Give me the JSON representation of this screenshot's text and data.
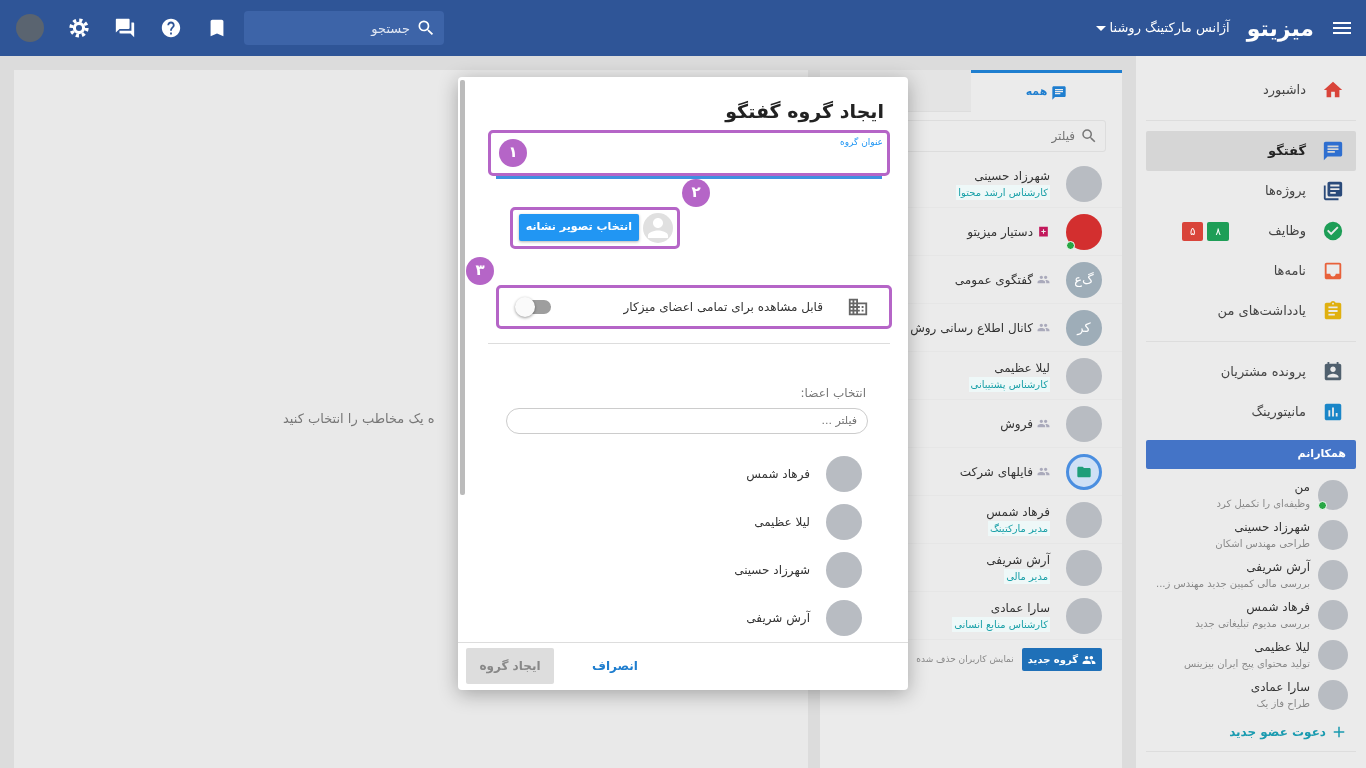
{
  "topbar": {
    "logo": "میزیتو",
    "workspace": "آژانس مارکتینگ روشنا",
    "search": {
      "placeholder": "جستجو"
    }
  },
  "sidebar": {
    "sections": [
      [
        {
          "label": "داشبورد",
          "selected": false
        }
      ],
      [
        {
          "label": "گفتگو",
          "selected": true
        },
        {
          "label": "پروژه‌ها",
          "selected": false
        },
        {
          "label": "وظایف",
          "selected": false,
          "badges": [
            {
              "text": "۸",
              "color": "#1e9e57"
            },
            {
              "text": "۵",
              "color": "#d9443a"
            }
          ]
        },
        {
          "label": "نامه‌ها",
          "selected": false
        },
        {
          "label": "یادداشت‌های من",
          "selected": false
        }
      ],
      [
        {
          "label": "پرونده مشتریان",
          "selected": false
        },
        {
          "label": "مانیتورینگ",
          "selected": false
        }
      ]
    ],
    "colleagues": {
      "title": "همکارانم",
      "items": [
        {
          "name": "من",
          "status": "وظیفه‌ای را تکمیل کرد",
          "online": true
        },
        {
          "name": "شهرزاد حسینی",
          "status": "طراحی مهندس اشکان",
          "online": false
        },
        {
          "name": "آرش شریفی",
          "status": "بررسی مالی کمپین جدید مهندس ز...",
          "online": false
        },
        {
          "name": "فرهاد شمس",
          "status": "بررسی مدیوم تبلیغاتی جدید",
          "online": false
        },
        {
          "name": "لیلا عظیمی",
          "status": "تولید محتوای پیج ایران بیزینس",
          "online": false
        },
        {
          "name": "سارا عمادی",
          "status": "طراح فاز یک",
          "online": false
        }
      ],
      "invite": "دعوت عضو جدید"
    }
  },
  "chat_list": {
    "tabs": [
      {
        "label": "همه",
        "selected": true
      },
      {
        "selected": false
      }
    ],
    "filter": {
      "placeholder": "فیلتر"
    },
    "items": [
      {
        "kind": "person",
        "avatar": {
          "kind": "photo"
        },
        "name": "شهرزاد حسینی",
        "role": "کارشناس ارشد محتوا"
      },
      {
        "kind": "bot",
        "avatar": {
          "kind": "logo"
        },
        "name": "دستیار میزیتو",
        "online": true
      },
      {
        "kind": "group",
        "avatar": {
          "kind": "initials",
          "initials": "گ‌ع"
        },
        "name": "گفتگوی عمومی"
      },
      {
        "kind": "channel",
        "avatar": {
          "kind": "initials",
          "initials": "کر"
        },
        "name": "کانال اطلاع رسانی روش"
      },
      {
        "kind": "person",
        "avatar": {
          "kind": "photo"
        },
        "name": "لیلا عظیمی",
        "role": "کارشناس پشتیبانی"
      },
      {
        "kind": "group",
        "avatar": {
          "kind": "photo"
        },
        "name": "فروش"
      },
      {
        "kind": "channel",
        "avatar": {
          "kind": "folder"
        },
        "name": "فایلهای شرکت"
      },
      {
        "kind": "person",
        "avatar": {
          "kind": "photo"
        },
        "name": "فرهاد شمس",
        "role": "مدیر مارکتینگ"
      },
      {
        "kind": "person",
        "avatar": {
          "kind": "photo"
        },
        "name": "آرش شریفی",
        "role": "مدیر مالی"
      },
      {
        "kind": "person",
        "avatar": {
          "kind": "photo"
        },
        "name": "سارا عمادی",
        "role": "کارشناس منابع انسانی"
      }
    ],
    "new_group_button": "گروه جدید",
    "show_deleted": "نمایش کاربران حذف شده"
  },
  "main": {
    "empty_message": "ه یک مخاطب را انتخاب کنید"
  },
  "modal": {
    "title": "ایجاد گروه گفتگو",
    "title_field": {
      "label": "عنوان گروه"
    },
    "steps": [
      "۱",
      "۲",
      "۳"
    ],
    "icon_button": "انتخاب تصویر نشانه",
    "visibility_toggle": {
      "label": "قابل مشاهده برای تمامی اعضای میزکار",
      "on": false
    },
    "members_label": "انتخاب اعضا:",
    "members_filter": {
      "placeholder": "فیلتر ..."
    },
    "members": [
      {
        "name": "فرهاد شمس"
      },
      {
        "name": "لیلا عظیمی"
      },
      {
        "name": "شهرزاد حسینی"
      },
      {
        "name": "آرش شریفی"
      }
    ],
    "cancel_button": "انصراف",
    "create_button": {
      "label": "ایجاد گروه",
      "disabled": true
    }
  }
}
